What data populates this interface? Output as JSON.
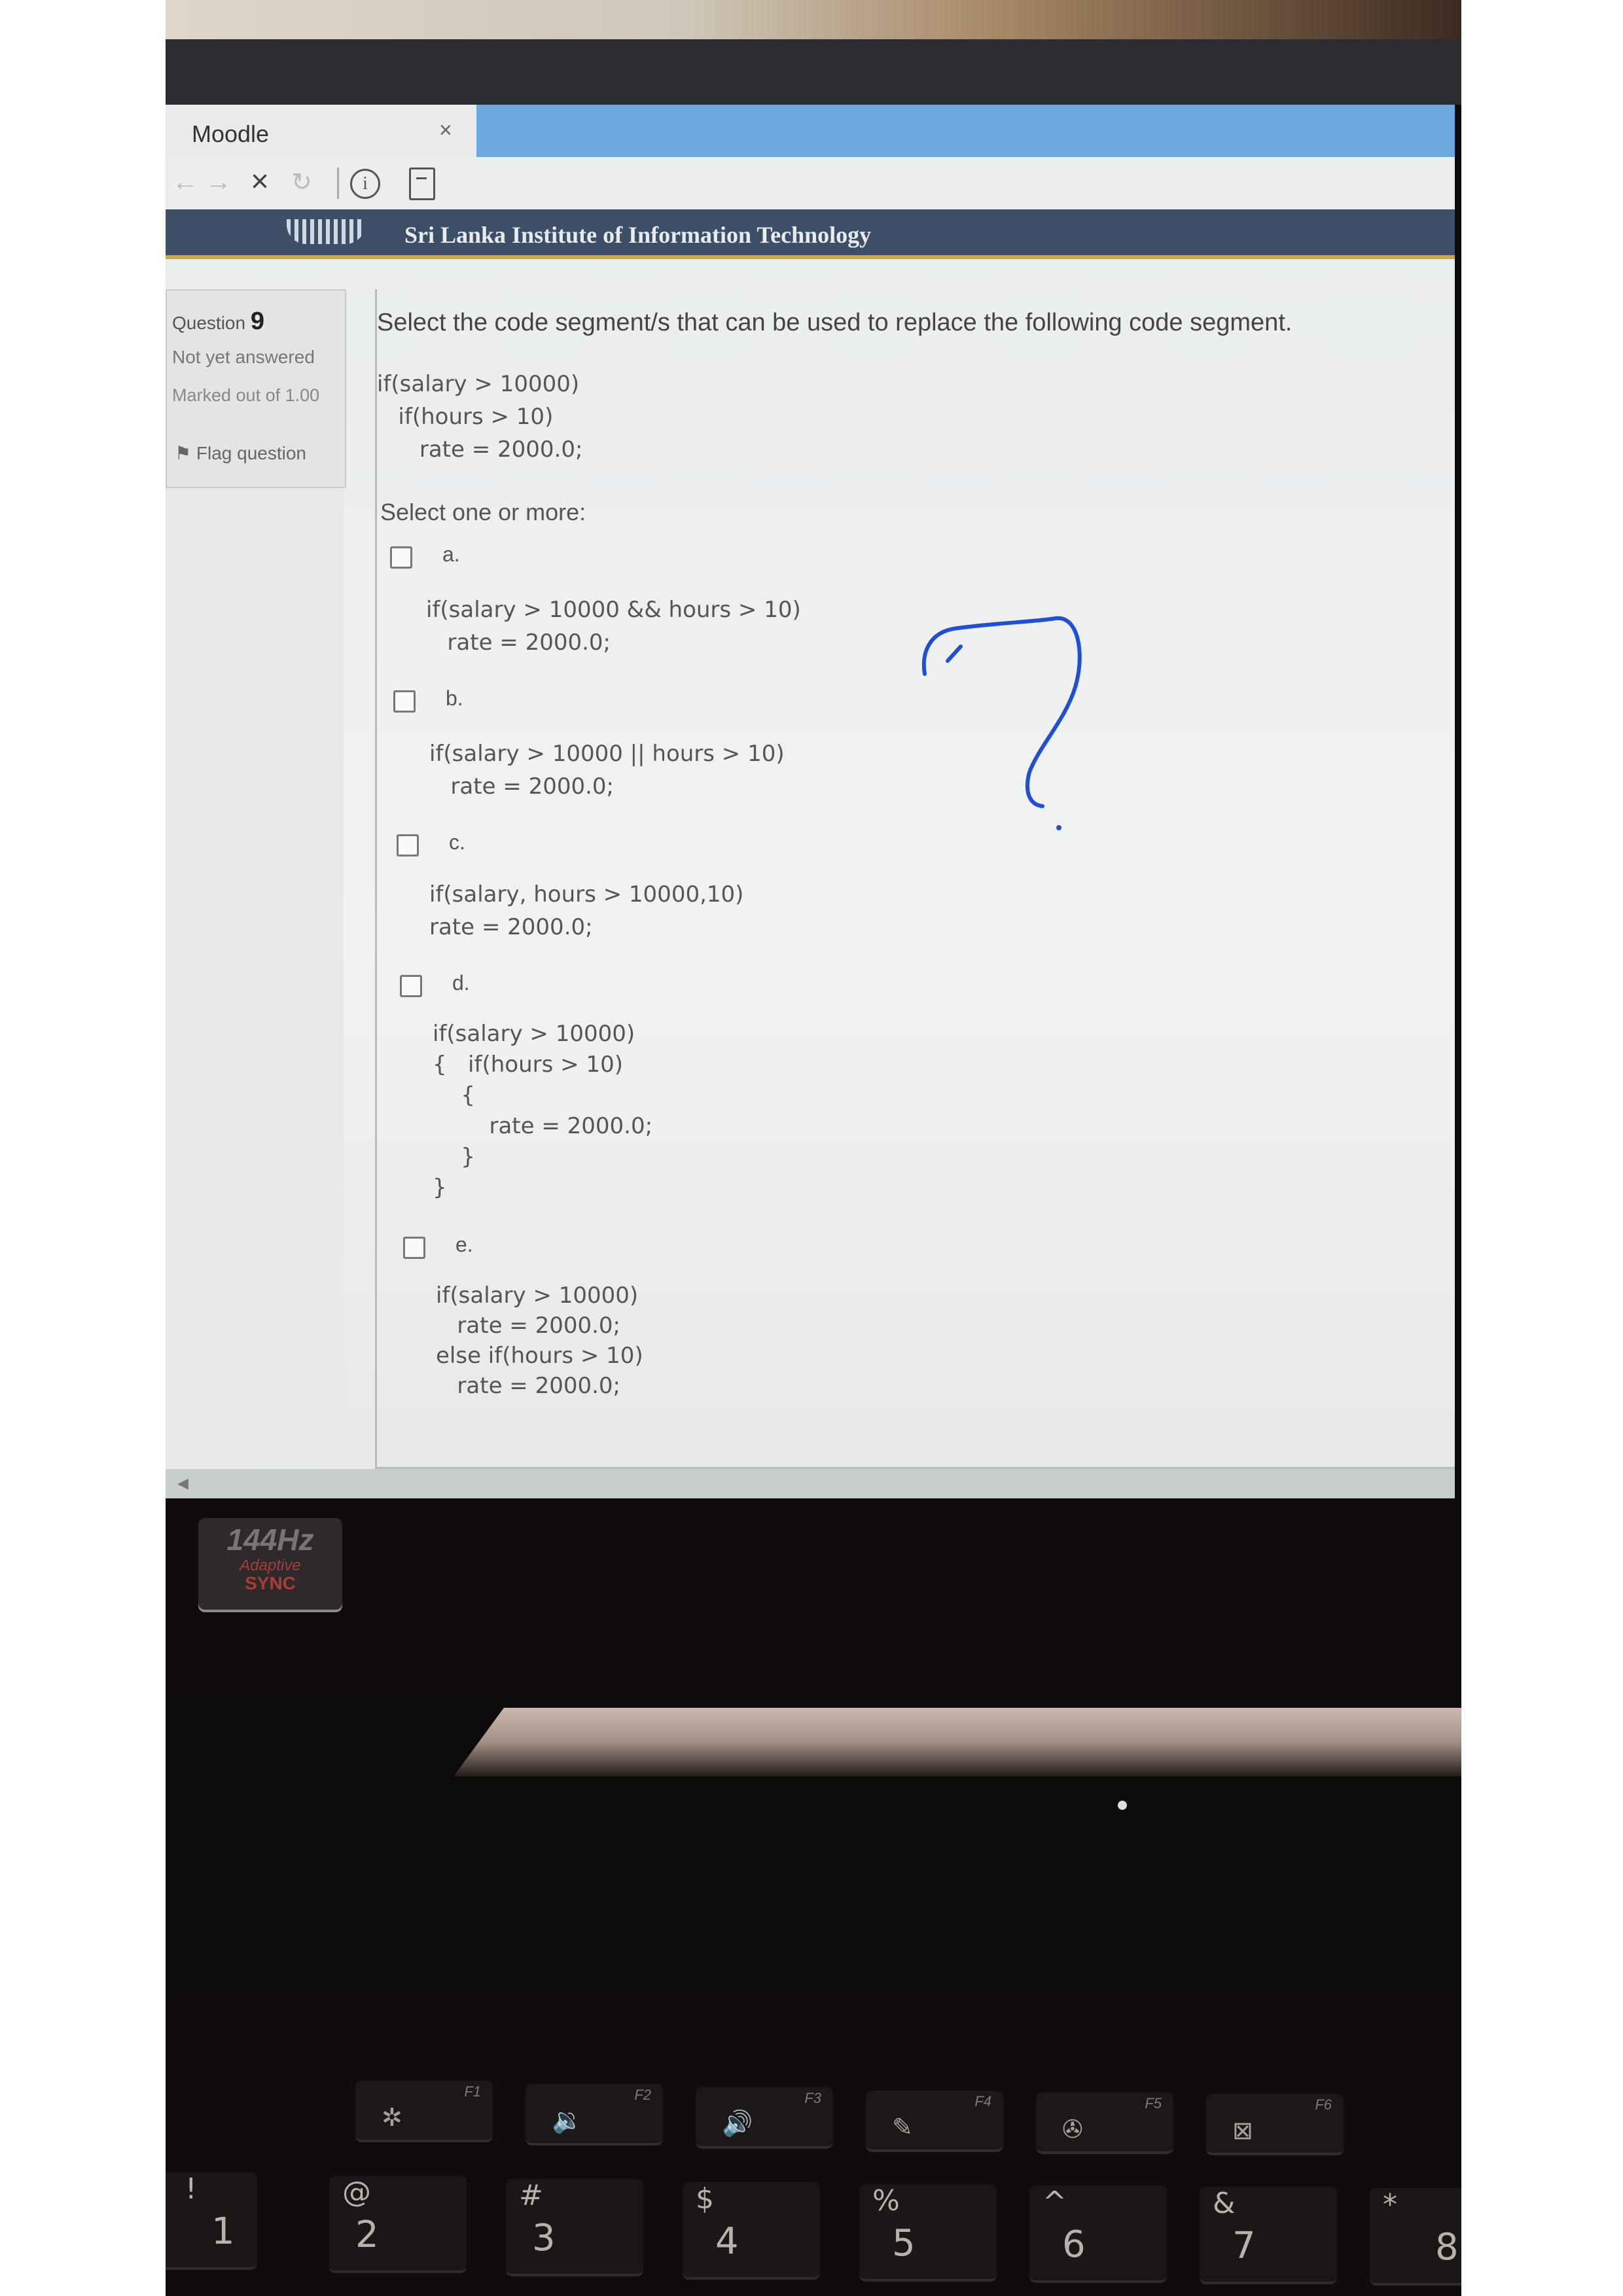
{
  "browser": {
    "tab_title": "Moodle",
    "tab_close": "×",
    "nav_back": "←",
    "nav_forward": "→",
    "nav_stop": "×",
    "nav_reload": "↻",
    "nav_info": "i"
  },
  "site": {
    "title": "Sri Lanka Institute of Information Technology"
  },
  "question_info": {
    "label": "Question",
    "number": "9",
    "status": "Not yet answered",
    "marked_out_of": "Marked out of 1.00",
    "flag": "Flag question"
  },
  "question": {
    "text": "Select the code segment/s that can be used to replace the following code segment.",
    "code": "if(salary > 10000)\n   if(hours > 10)\n      rate = 2000.0;",
    "prompt": "Select one or more:",
    "options": [
      {
        "letter": "a.",
        "code": "if(salary > 10000 && hours > 10)\n   rate = 2000.0;"
      },
      {
        "letter": "b.",
        "code": "if(salary > 10000 || hours > 10)\n   rate = 2000.0;"
      },
      {
        "letter": "c.",
        "code": "if(salary, hours > 10000,10)\nrate = 2000.0;"
      },
      {
        "letter": "d.",
        "code": "if(salary > 10000)\n{   if(hours > 10)\n    {\n        rate = 2000.0;\n    }\n}"
      },
      {
        "letter": "e.",
        "code": "if(salary > 10000)\n   rate = 2000.0;\nelse if(hours > 10)\n   rate = 2000.0;"
      }
    ]
  },
  "annotation": {
    "mark": "?",
    "color": "#1f4fd6"
  },
  "laptop": {
    "badge_line1": "144Hz",
    "badge_line2": "Adaptive",
    "badge_line3": "SYNC",
    "fkeys": [
      "F1",
      "F2",
      "F3",
      "F4",
      "F5",
      "F6"
    ],
    "number_keys": [
      {
        "top": "!",
        "main": "1"
      },
      {
        "top": "@",
        "main": "2"
      },
      {
        "top": "#",
        "main": "3"
      },
      {
        "top": "$",
        "main": "4"
      },
      {
        "top": "%",
        "main": "5"
      },
      {
        "top": "^",
        "main": "6"
      },
      {
        "top": "&",
        "main": "7"
      },
      {
        "top": "*",
        "main": "8"
      }
    ]
  }
}
